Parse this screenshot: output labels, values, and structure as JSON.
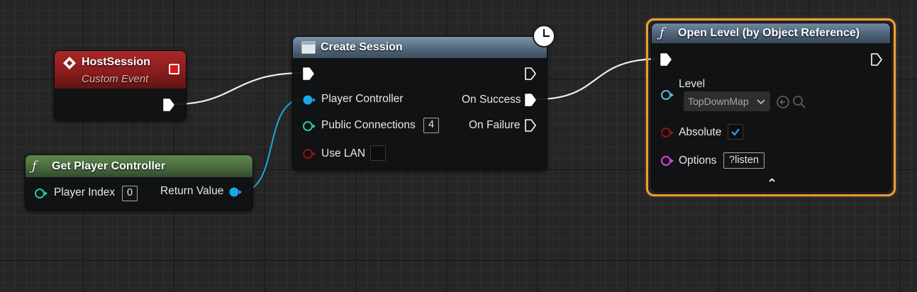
{
  "nodes": {
    "host_session": {
      "title": "HostSession",
      "subtitle": "Custom Event"
    },
    "get_player_controller": {
      "func_glyph": "ƒ",
      "title": "Get Player Controller",
      "player_index_label": "Player Index",
      "player_index_value": "0",
      "return_value_label": "Return Value"
    },
    "create_session": {
      "title": "Create Session",
      "player_controller_label": "Player Controller",
      "public_connections_label": "Public Connections",
      "public_connections_value": "4",
      "use_lan_label": "Use LAN",
      "on_success_label": "On Success",
      "on_failure_label": "On Failure"
    },
    "open_level": {
      "func_glyph": "ƒ",
      "title": "Open Level (by Object Reference)",
      "level_label": "Level",
      "level_value": "TopDownMap",
      "absolute_label": "Absolute",
      "absolute_checked": true,
      "options_label": "Options",
      "options_value": "?listen",
      "collapse_glyph": "⌃"
    }
  },
  "colors": {
    "event_header": "#8b1d1d",
    "pure_function_header": "#4b6a3c",
    "function_header": "#4a5f74",
    "object_pin": "#1aa6e6",
    "int_pin": "#28c8a0",
    "bool_pin": "#8c1414",
    "string_pin": "#e040e8",
    "selection_outline": "#f2a330",
    "wire_exec": "#f0f0f0"
  }
}
